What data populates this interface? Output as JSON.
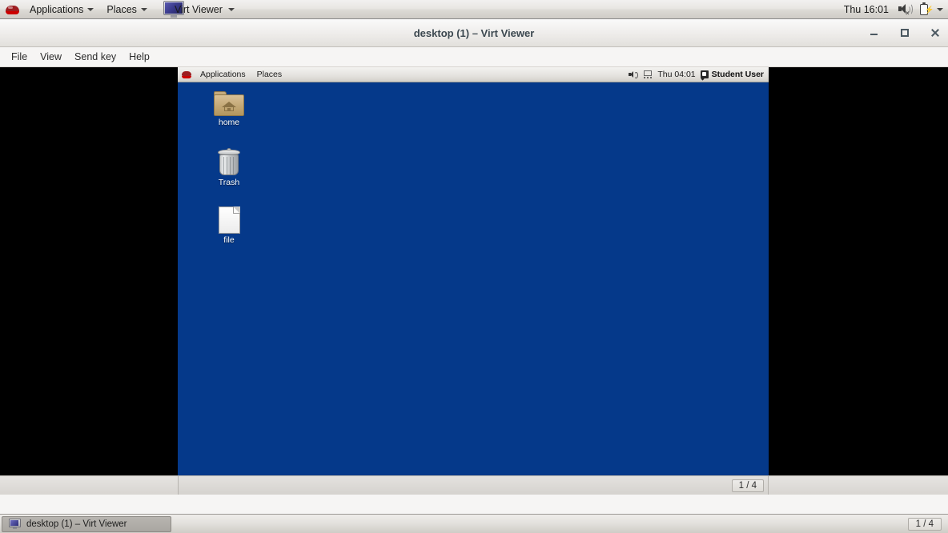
{
  "host_panel": {
    "logo_icon": "redhat-logo-icon",
    "applications_label": "Applications",
    "places_label": "Places",
    "window_entry_label": "Virt Viewer",
    "window_entry_icon": "monitor-icon",
    "clock": "Thu 16:01",
    "volume_icon": "speaker-muted-icon",
    "battery_icon": "battery-charging-icon",
    "tray_caret_icon": "chevron-down-icon"
  },
  "virt_viewer_window": {
    "title": "desktop (1) – Virt Viewer",
    "controls": {
      "minimize": "minimize-icon",
      "maximize": "maximize-icon",
      "close": "close-icon"
    },
    "menu": [
      {
        "label": "File"
      },
      {
        "label": "View"
      },
      {
        "label": "Send key"
      },
      {
        "label": "Help"
      }
    ],
    "status_pager": "1 / 4"
  },
  "vm_screen": {
    "panel": {
      "logo_icon": "redhat-logo-icon",
      "applications_label": "Applications",
      "places_label": "Places",
      "volume_icon": "speaker-icon",
      "display_icon": "network-display-icon",
      "clock": "Thu 04:01",
      "user_icon": "user-icon",
      "user_label": "Student User"
    },
    "desktop_background": "#05398a",
    "icons": [
      {
        "name": "home",
        "label": "home",
        "icon": "home-folder-icon"
      },
      {
        "name": "trash",
        "label": "Trash",
        "icon": "trash-can-icon"
      },
      {
        "name": "file",
        "label": "file",
        "icon": "document-icon"
      }
    ]
  },
  "taskbar": {
    "items": [
      {
        "label": "desktop (1) – Virt Viewer",
        "icon": "monitor-icon"
      }
    ],
    "workspace_pager": "1 / 4"
  }
}
